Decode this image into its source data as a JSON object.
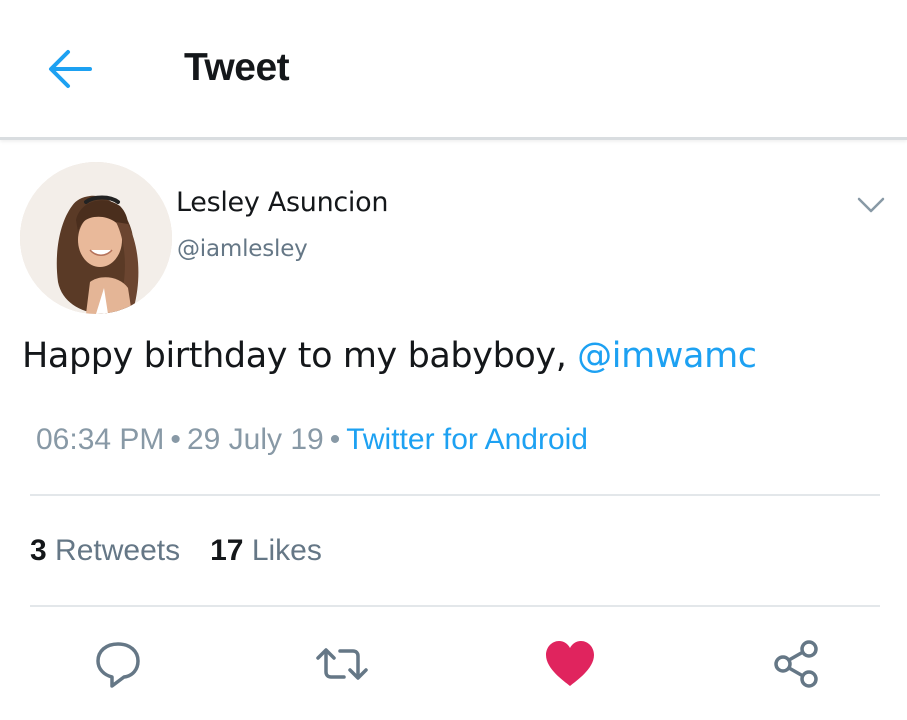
{
  "header": {
    "back_icon": "arrow-left-icon",
    "title": "Tweet"
  },
  "author": {
    "display_name": "Lesley Asuncion",
    "handle": "@iamlesley"
  },
  "tweet": {
    "text": "Happy birthday to my babyboy, ",
    "mention": "@imwamc"
  },
  "meta": {
    "time": "06:34 PM",
    "separator": "•",
    "date": "29 July 19",
    "source": "Twitter for Android"
  },
  "stats": {
    "retweets_count": "3",
    "retweets_label": "Retweets",
    "likes_count": "17",
    "likes_label": "Likes"
  },
  "actions": {
    "reply_icon": "reply-icon",
    "retweet_icon": "retweet-icon",
    "like_icon": "heart-icon",
    "share_icon": "share-icon"
  },
  "colors": {
    "accent": "#1da1f2",
    "like": "#e0245e",
    "text": "#14171a",
    "muted": "#657786"
  }
}
